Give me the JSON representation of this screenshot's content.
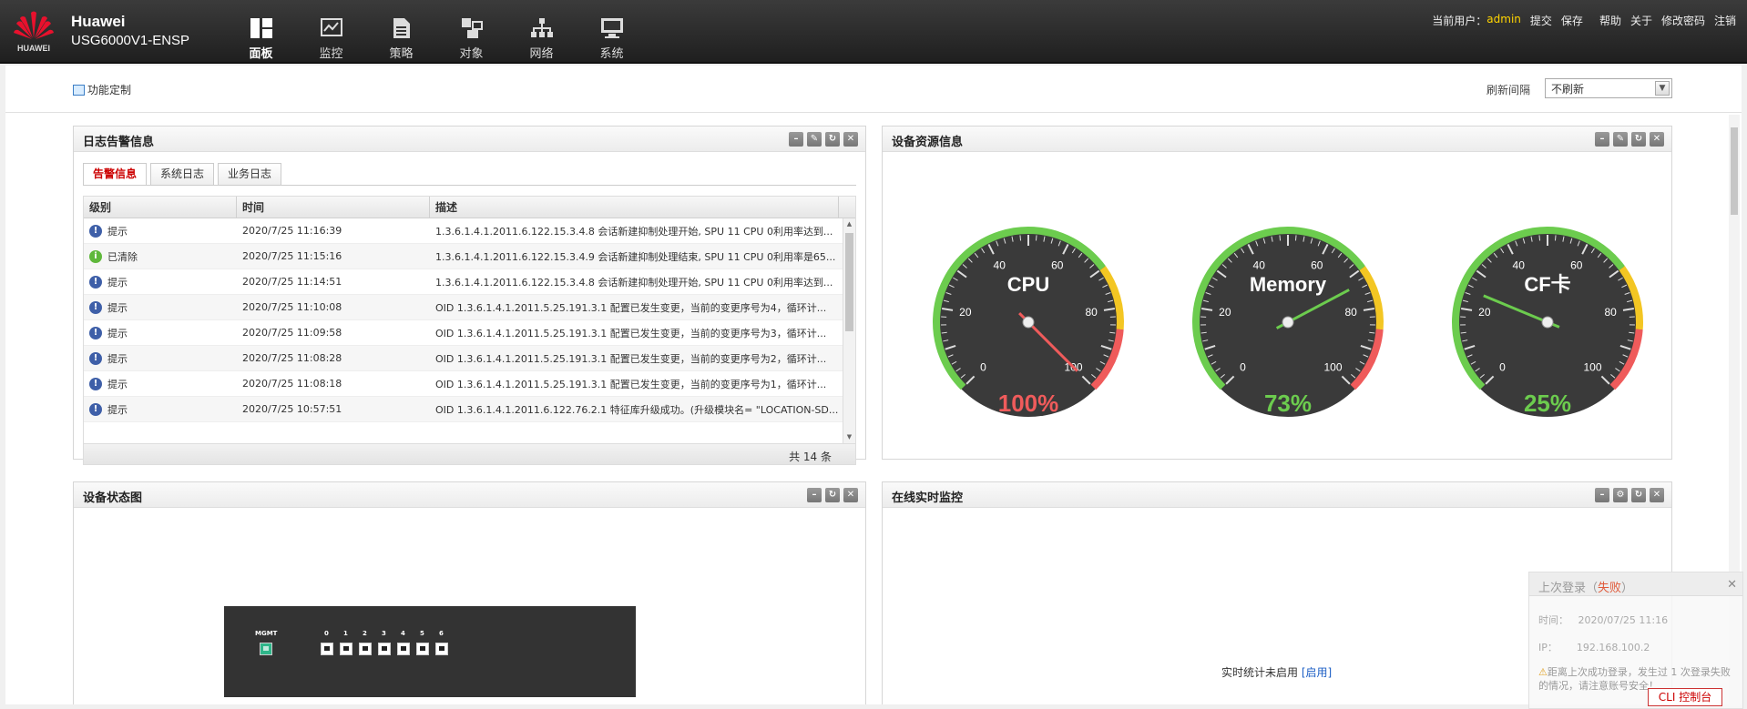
{
  "header": {
    "logo_text": "HUAWEI",
    "brand": "Huawei",
    "model": "USG6000V1-ENSP",
    "nav": [
      {
        "label": "面板",
        "icon": "dashboard-icon"
      },
      {
        "label": "监控",
        "icon": "monitor-icon"
      },
      {
        "label": "策略",
        "icon": "policy-icon"
      },
      {
        "label": "对象",
        "icon": "object-icon"
      },
      {
        "label": "网络",
        "icon": "network-icon"
      },
      {
        "label": "系统",
        "icon": "system-icon"
      }
    ],
    "user_label": "当前用户：",
    "user": "admin",
    "links": [
      "提交",
      "保存",
      "帮助",
      "关于",
      "修改密码",
      "注销"
    ]
  },
  "toolbar": {
    "func_custom": "功能定制",
    "refresh_label": "刷新间隔",
    "refresh_value": "不刷新"
  },
  "log_panel": {
    "title": "日志告警信息",
    "tabs": [
      "告警信息",
      "系统日志",
      "业务日志"
    ],
    "columns": [
      "级别",
      "时间",
      "描述"
    ],
    "rows": [
      {
        "level": "提示",
        "kind": "info",
        "time": "2020/7/25 11:16:39",
        "desc": "1.3.6.1.4.1.2011.6.122.15.3.4.8 会话新建抑制处理开始, SPU 11 CPU 0利用率达到..."
      },
      {
        "level": "已清除",
        "kind": "ok",
        "time": "2020/7/25 11:15:16",
        "desc": "1.3.6.1.4.1.2011.6.122.15.3.4.9 会话新建抑制处理结束, SPU 11 CPU 0利用率是65..."
      },
      {
        "level": "提示",
        "kind": "info",
        "time": "2020/7/25 11:14:51",
        "desc": "1.3.6.1.4.1.2011.6.122.15.3.4.8 会话新建抑制处理开始, SPU 11 CPU 0利用率达到..."
      },
      {
        "level": "提示",
        "kind": "info",
        "time": "2020/7/25 11:10:08",
        "desc": "OID 1.3.6.1.4.1.2011.5.25.191.3.1 配置已发生变更，当前的变更序号为4，循环计..."
      },
      {
        "level": "提示",
        "kind": "info",
        "time": "2020/7/25 11:09:58",
        "desc": "OID 1.3.6.1.4.1.2011.5.25.191.3.1 配置已发生变更，当前的变更序号为3，循环计..."
      },
      {
        "level": "提示",
        "kind": "info",
        "time": "2020/7/25 11:08:28",
        "desc": "OID 1.3.6.1.4.1.2011.5.25.191.3.1 配置已发生变更，当前的变更序号为2，循环计..."
      },
      {
        "level": "提示",
        "kind": "info",
        "time": "2020/7/25 11:08:18",
        "desc": "OID 1.3.6.1.4.1.2011.5.25.191.3.1 配置已发生变更，当前的变更序号为1，循环计..."
      },
      {
        "level": "提示",
        "kind": "info",
        "time": "2020/7/25 10:57:51",
        "desc": "OID 1.3.6.1.4.1.2011.6.122.76.2.1 特征库升级成功。(升级模块名= \"LOCATION-SD..."
      }
    ],
    "total": "共 14 条"
  },
  "resource_panel": {
    "title": "设备资源信息",
    "gauges": [
      {
        "name": "CPU",
        "value": 100,
        "label": "100%",
        "value_color": "#ef5b5b"
      },
      {
        "name": "Memory",
        "value": 73,
        "label": "73%",
        "value_color": "#6ccc4e"
      },
      {
        "name": "CF卡",
        "value": 25,
        "label": "25%",
        "value_color": "#6ccc4e"
      }
    ],
    "ticks": [
      "0",
      "20",
      "40",
      "60",
      "80",
      "100"
    ]
  },
  "status_panel": {
    "title": "设备状态图",
    "mgmt_label": "MGMT",
    "ports": [
      "0",
      "1",
      "2",
      "3",
      "4",
      "5",
      "6"
    ]
  },
  "monitor_panel": {
    "title": "在线实时监控",
    "text": "实时统计未启用",
    "link": "[启用]"
  },
  "login_toast": {
    "title": "上次登录（",
    "status": "失败",
    "title_end": "）",
    "time_label": "时间：",
    "time": "2020/07/25 11:16",
    "ip_label": "IP：",
    "ip": "192.168.100.2",
    "warning": "距离上次成功登录，发生过 1 次登录失败的情况，请注意账号安全！",
    "cli": "CLI 控制台"
  },
  "colors": {
    "header_bg": "#2a2a2a",
    "admin": "#ffd400",
    "alert_tab": "#cc0000",
    "gauge_green": "#6ccc4e",
    "gauge_yellow": "#f3c623",
    "gauge_red": "#ef5b5b"
  }
}
